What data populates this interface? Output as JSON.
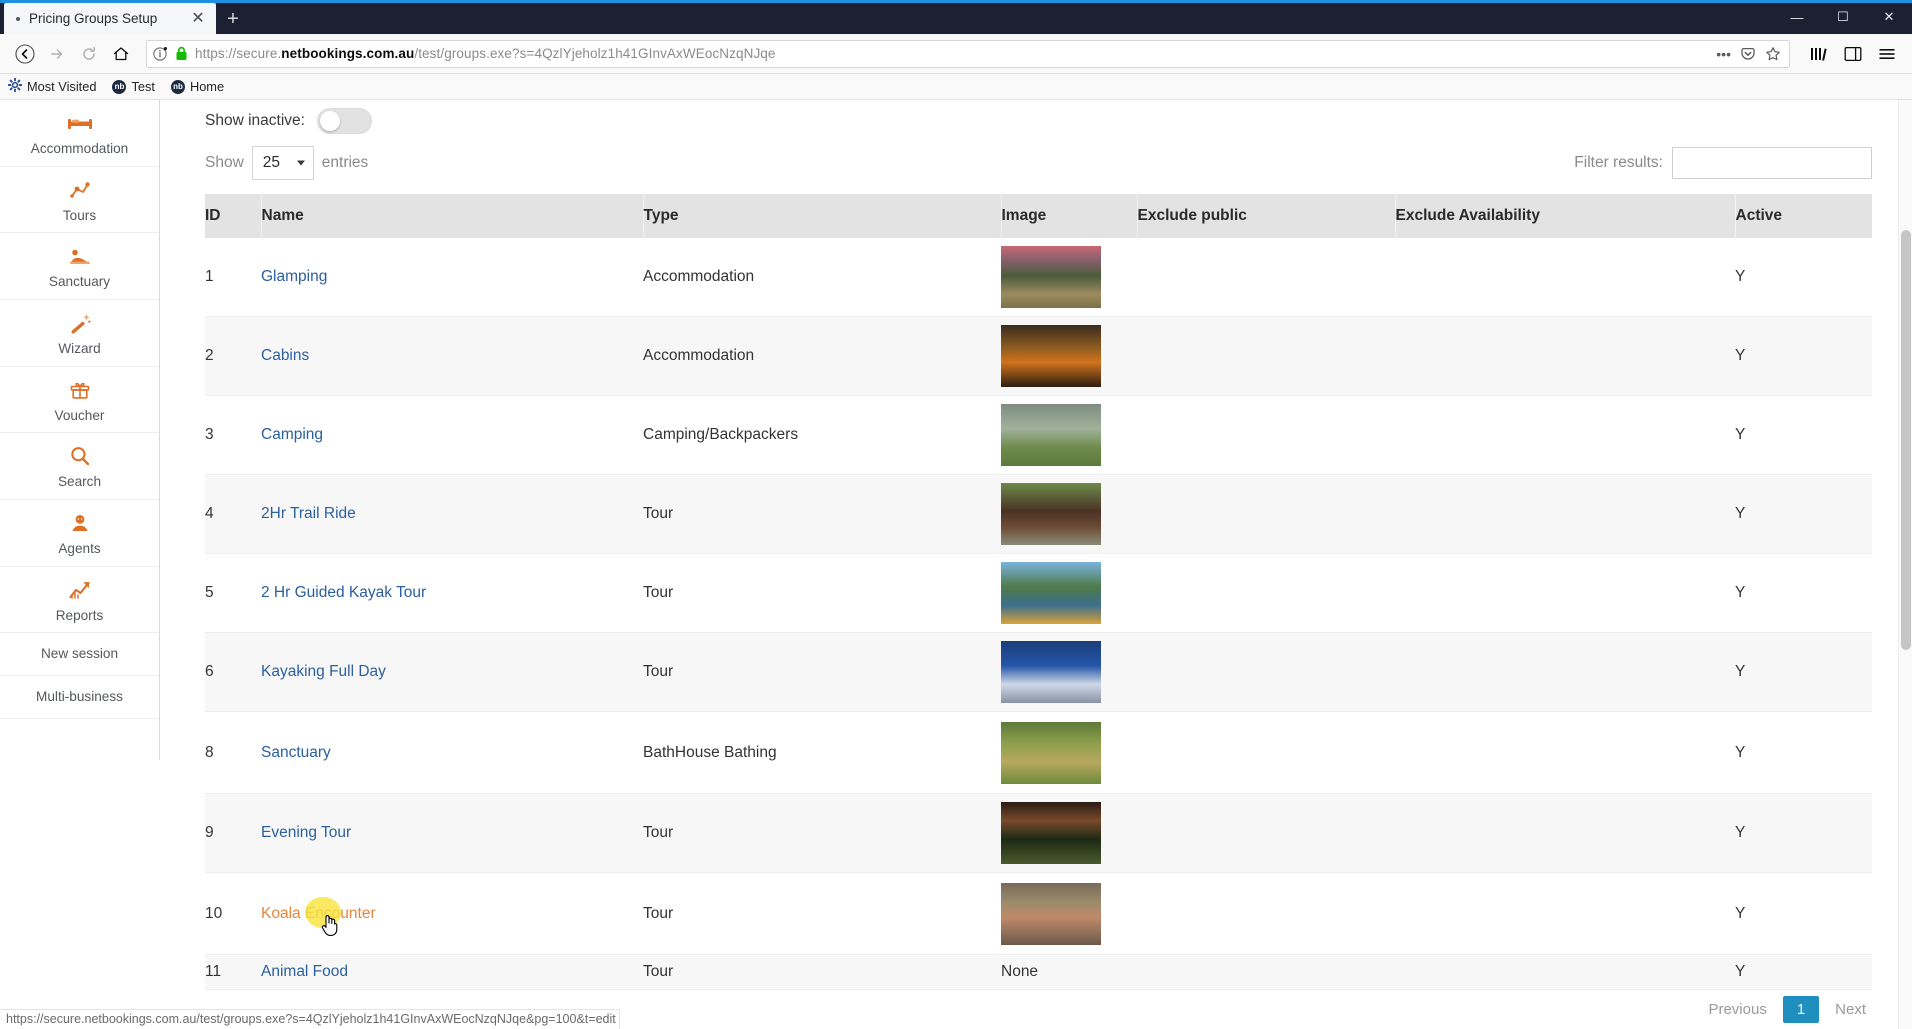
{
  "browser": {
    "tab": {
      "title": "Pricing Groups Setup",
      "close_label": "✕"
    },
    "new_tab_label": "+",
    "window_controls": {
      "minimize": "—",
      "maximize": "☐",
      "close": "✕"
    },
    "nav": {
      "back": "←",
      "forward": "→",
      "reload": "↻",
      "home": "⌂",
      "page_actions": "•••",
      "pocket": "save-to-pocket",
      "bookmark_star": "☆",
      "library": "library",
      "sidebars": "sidebars",
      "menu": "≡"
    },
    "url": {
      "scheme": "https://secure.",
      "domain": "netbookings.com.au",
      "path": "/test/groups.exe?s=4QzlYjeholz1h41GInvAxWEocNzqNJqe",
      "full": "https://secure.netbookings.com.au/test/groups.exe?s=4QzlYjeholz1h41GInvAxWEocNzqNJqe"
    },
    "bookmarks": [
      {
        "label": "Most Visited",
        "icon": "gear-icon",
        "favicon_text": ""
      },
      {
        "label": "Test",
        "icon": "nb-favicon",
        "favicon_text": "nb"
      },
      {
        "label": "Home",
        "icon": "nb-favicon",
        "favicon_text": "nb"
      }
    ],
    "statusbar_url": "https://secure.netbookings.com.au/test/groups.exe?s=4QzlYjeholz1h41GInvAxWEocNzqNJqe&pg=100&t=edit"
  },
  "sidebar": {
    "items": [
      {
        "label": "Accommodation",
        "icon": "bed-icon"
      },
      {
        "label": "Tours",
        "icon": "tours-icon"
      },
      {
        "label": "Sanctuary",
        "icon": "sanctuary-icon"
      },
      {
        "label": "Wizard",
        "icon": "magic-wand-icon"
      },
      {
        "label": "Voucher",
        "icon": "gift-icon"
      },
      {
        "label": "Search",
        "icon": "search-icon"
      },
      {
        "label": "Agents",
        "icon": "agent-icon"
      },
      {
        "label": "Reports",
        "icon": "chart-up-icon"
      },
      {
        "label": "New session",
        "icon": ""
      },
      {
        "label": "Multi-business",
        "icon": ""
      }
    ]
  },
  "main": {
    "show_inactive_label": "Show inactive:",
    "show_inactive_on": false,
    "length_prefix": "Show",
    "length_value": "25",
    "length_suffix": "entries",
    "filter_label": "Filter results:",
    "filter_value": "",
    "filter_placeholder": "",
    "columns": [
      "ID",
      "Name",
      "Type",
      "Image",
      "Exclude public",
      "Exclude Availability",
      "Active"
    ],
    "rows": [
      {
        "id": "1",
        "name": "Glamping",
        "type": "Accommodation",
        "image": "thumb",
        "thumb_style": "linear-gradient(180deg,#c76a74 0%,#8a5f6d 22%,#4b5c3b 48%,#9d8b5f 78%,#7c7248 100%)",
        "exclude_public": "",
        "exclude_availability": "",
        "active": "Y",
        "hovered": false
      },
      {
        "id": "2",
        "name": "Cabins",
        "type": "Accommodation",
        "image": "thumb",
        "thumb_style": "linear-gradient(180deg,#3a2a1c 0%,#8a5a22 35%,#d1731b 60%,#2d1d12 100%)",
        "exclude_public": "",
        "exclude_availability": "",
        "active": "Y",
        "hovered": false
      },
      {
        "id": "3",
        "name": "Camping",
        "type": "Camping/Backpackers",
        "image": "thumb",
        "thumb_style": "linear-gradient(180deg,#7e8d82 0%,#9fb29a 40%,#6f8b4c 70%,#5c7a3c 100%)",
        "exclude_public": "",
        "exclude_availability": "",
        "active": "Y",
        "hovered": false
      },
      {
        "id": "4",
        "name": "2Hr Trail Ride",
        "type": "Tour",
        "image": "thumb",
        "thumb_style": "linear-gradient(180deg,#6d8a4b 0%,#4a3224 45%,#6b4a33 70%,#8a8a78 100%)",
        "exclude_public": "",
        "exclude_availability": "",
        "active": "Y",
        "hovered": false
      },
      {
        "id": "5",
        "name": "2 Hr Guided Kayak Tour",
        "type": "Tour",
        "image": "thumb",
        "thumb_style": "linear-gradient(180deg,#7ab3dd 0%,#4f7a4a 40%,#3c6f8c 70%,#d9a33a 100%)",
        "exclude_public": "",
        "exclude_availability": "",
        "active": "Y",
        "hovered": false
      },
      {
        "id": "6",
        "name": "Kayaking Full Day",
        "type": "Tour",
        "image": "thumb",
        "thumb_style": "linear-gradient(180deg,#1b3d7a 0%,#2456a8 40%,#cfd8e6 70%,#8892a3 100%)",
        "exclude_public": "",
        "exclude_availability": "",
        "active": "Y",
        "hovered": false
      },
      {
        "id": "8",
        "name": "Sanctuary",
        "type": "BathHouse Bathing",
        "image": "thumb",
        "thumb_style": "linear-gradient(180deg,#5d7a3a 0%,#8ea04c 35%,#b8a85f 65%,#6f8a3c 100%)",
        "exclude_public": "",
        "exclude_availability": "",
        "active": "Y",
        "hovered": false
      },
      {
        "id": "9",
        "name": "Evening Tour",
        "type": "Tour",
        "image": "thumb",
        "thumb_style": "linear-gradient(180deg,#2a1c14 0%,#7a4a2c 30%,#1d2a14 60%,#4a5a2c 100%)",
        "exclude_public": "",
        "exclude_availability": "",
        "active": "Y",
        "hovered": false
      },
      {
        "id": "10",
        "name": "Koala Encounter",
        "type": "Tour",
        "image": "thumb",
        "thumb_style": "linear-gradient(180deg,#7a6a5c 0%,#9a8a6a 30%,#c08a6a 55%,#6a5a4a 100%)",
        "exclude_public": "",
        "exclude_availability": "",
        "active": "Y",
        "hovered": true
      },
      {
        "id": "11",
        "name": "Animal Food",
        "type": "Tour",
        "image": "None",
        "thumb_style": "",
        "exclude_public": "",
        "exclude_availability": "",
        "active": "Y",
        "hovered": false
      }
    ],
    "pagination": {
      "previous": "Previous",
      "current": "1",
      "next": "Next"
    }
  },
  "colors": {
    "accent_orange": "#e0721f",
    "link_blue": "#2b5f9e",
    "hover_orange": "#e8843c",
    "page_badge_blue": "#1f8fc0",
    "highlight_yellow": "#f7e33f"
  }
}
